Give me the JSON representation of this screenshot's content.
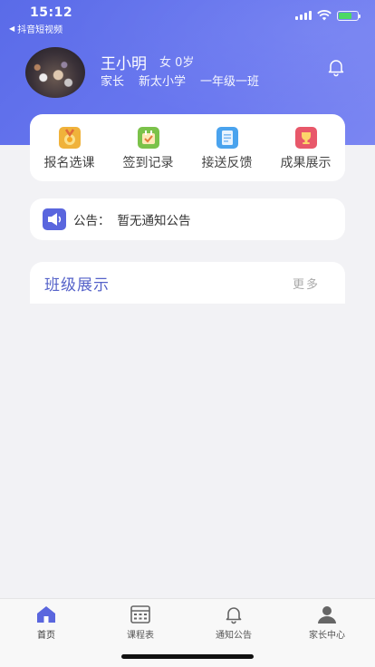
{
  "status_bar": {
    "time": "15:12",
    "back_app": "抖音短视频"
  },
  "profile": {
    "name": "王小明",
    "gender_age": "女 0岁",
    "role": "家长",
    "school": "新太小学",
    "class": "一年级一班"
  },
  "quick_actions": [
    {
      "label": "报名选课",
      "icon": "medal-icon",
      "color": "#f0b23a"
    },
    {
      "label": "签到记录",
      "icon": "checkin-icon",
      "color": "#7bc24a"
    },
    {
      "label": "接送反馈",
      "icon": "notebook-icon",
      "color": "#4aa3ee"
    },
    {
      "label": "成果展示",
      "icon": "trophy-icon",
      "color": "#e8586a"
    }
  ],
  "notice": {
    "label": "公告：",
    "text": "暂无通知公告"
  },
  "class_section": {
    "title": "班级展示",
    "more": "更多"
  },
  "tabbar": {
    "items": [
      {
        "label": "首页",
        "icon": "home-icon",
        "active": true
      },
      {
        "label": "课程表",
        "icon": "calendar-icon",
        "active": false
      },
      {
        "label": "通知公告",
        "icon": "bell-icon",
        "active": false
      },
      {
        "label": "家长中心",
        "icon": "person-icon",
        "active": false
      }
    ]
  },
  "colors": {
    "accent": "#5a6be8",
    "page_bg": "#f2f2f5",
    "tab_active": "#5a66de"
  }
}
